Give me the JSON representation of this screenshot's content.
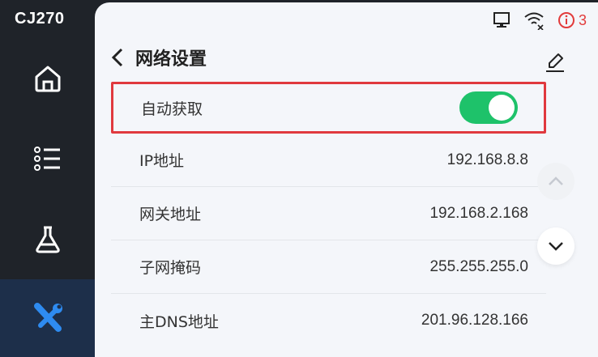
{
  "device": {
    "name": "CJ270"
  },
  "sidebar": {
    "items": [
      "home-icon",
      "list-icon",
      "flask-icon",
      "tools-icon"
    ],
    "active_index": 3
  },
  "status_bar": {
    "alert_count": "3"
  },
  "header": {
    "title": "网络设置"
  },
  "rows": [
    {
      "label": "自动获取",
      "toggle_on": true
    },
    {
      "label": "IP地址",
      "value": "192.168.8.8"
    },
    {
      "label": "网关地址",
      "value": "192.168.2.168"
    },
    {
      "label": "子网掩码",
      "value": "255.255.255.0"
    },
    {
      "label": "主DNS地址",
      "value": "201.96.128.166"
    }
  ],
  "colors": {
    "accent": "#1ec26a",
    "alert": "#e23b3b",
    "active_nav": "#1d2f4a",
    "highlight_border": "#e0393e"
  }
}
